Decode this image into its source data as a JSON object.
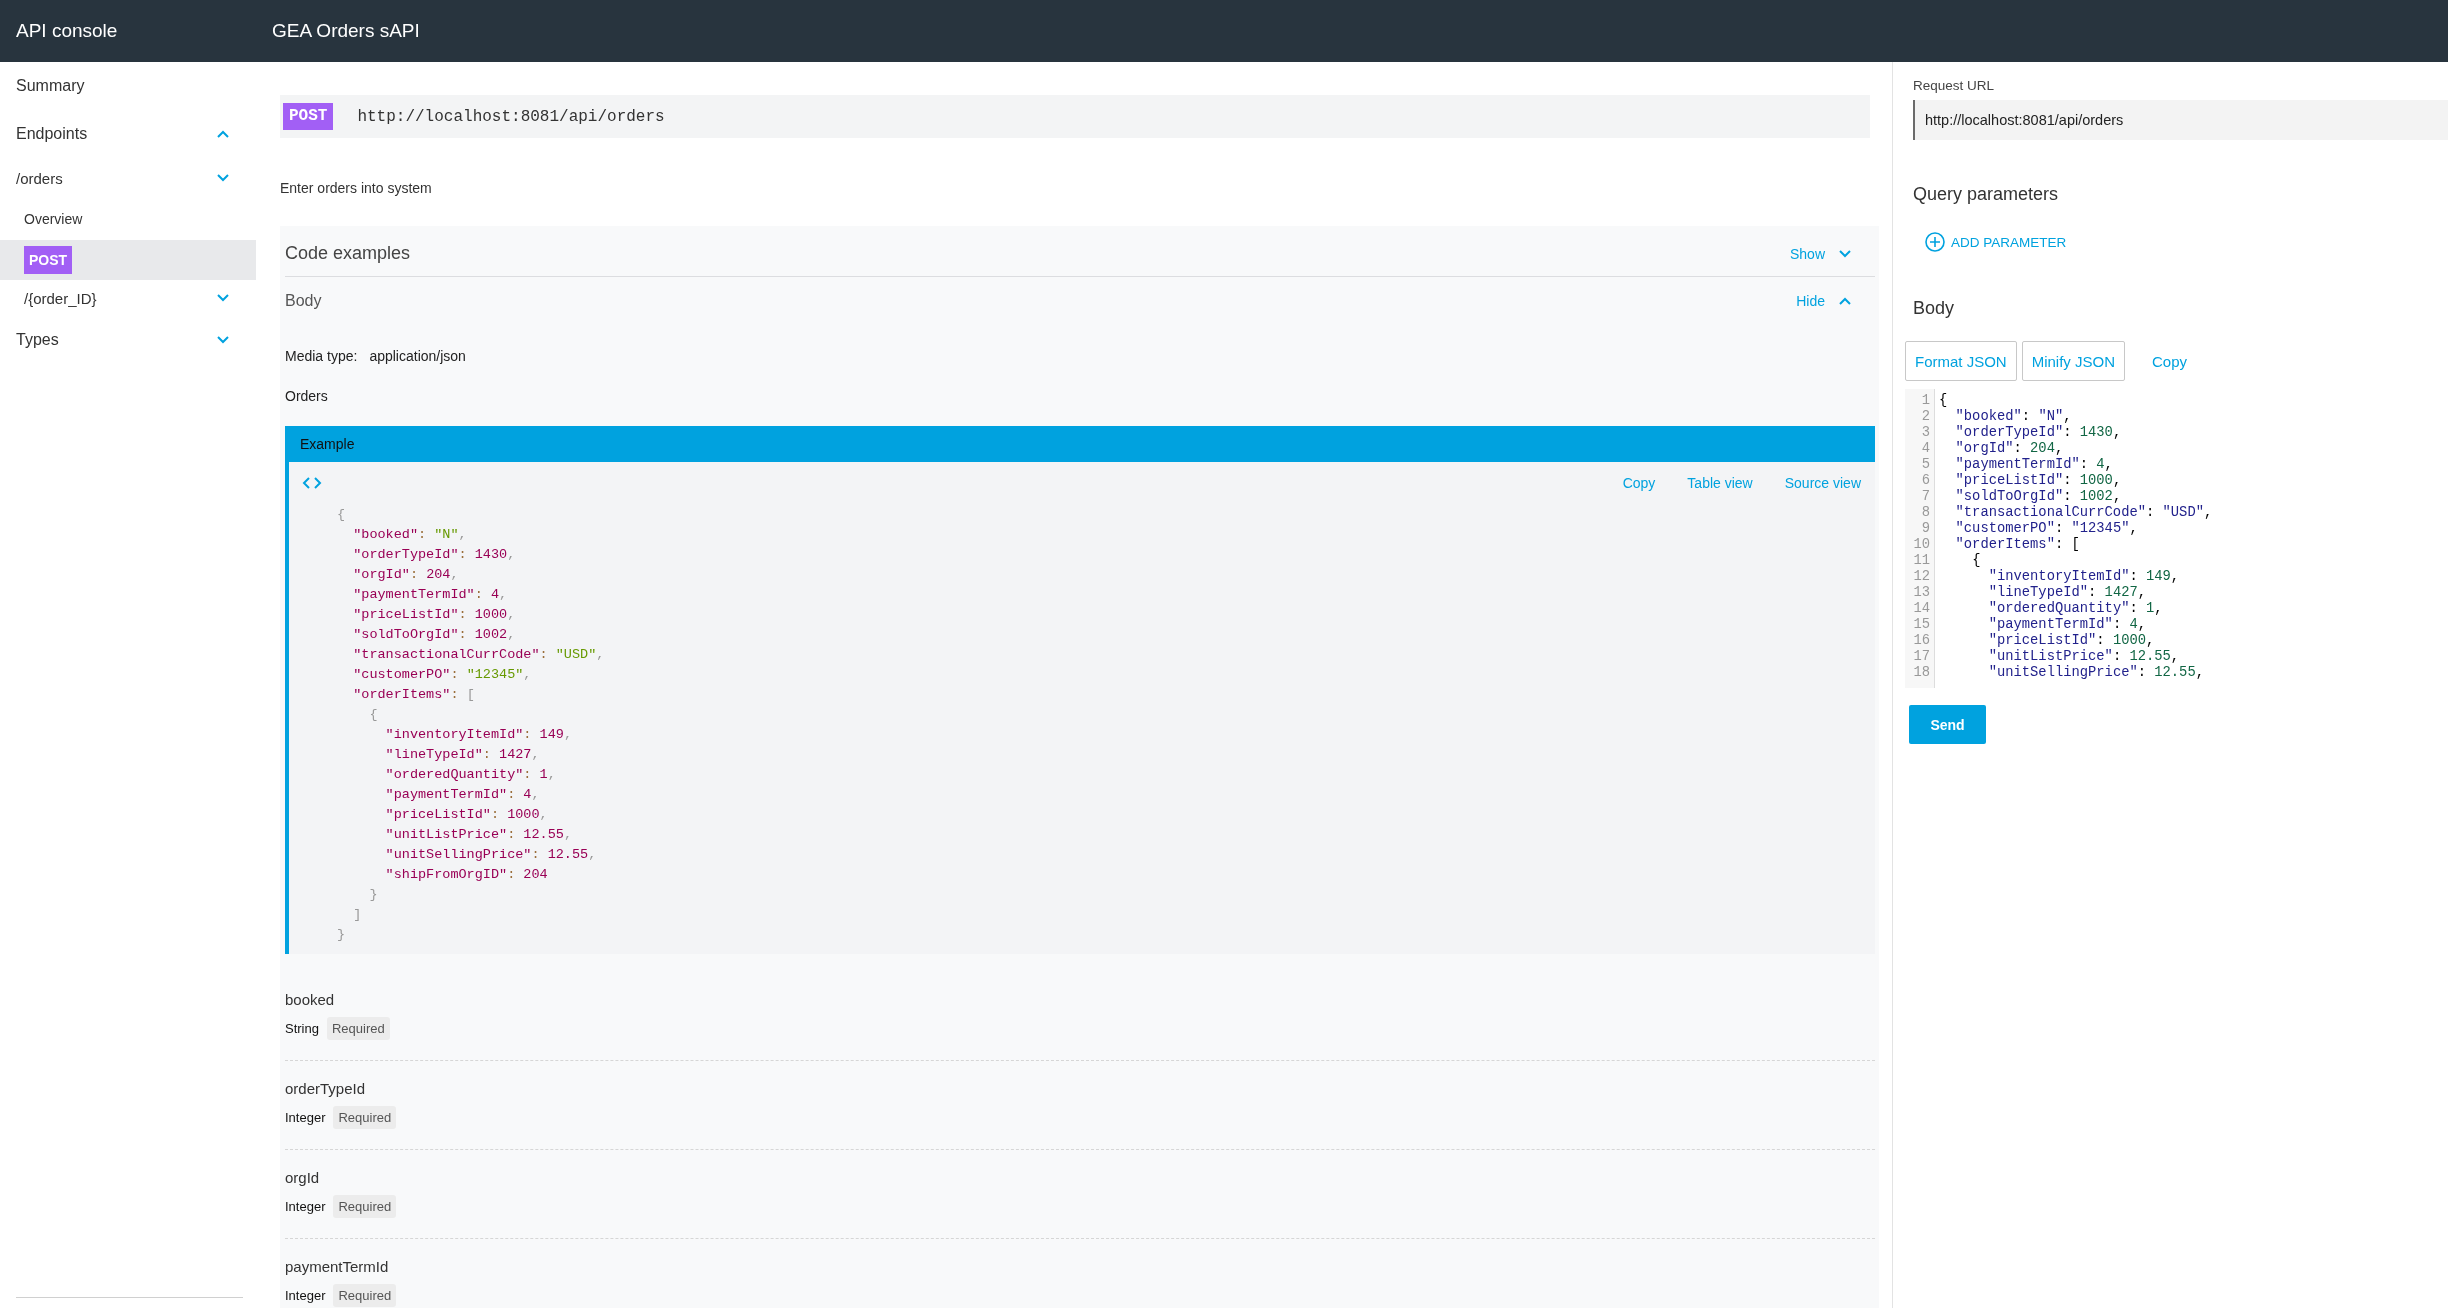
{
  "header": {
    "app_title": "API console",
    "api_title": "GEA Orders sAPI"
  },
  "sidebar": {
    "items": [
      {
        "kind": "heading",
        "label": "Summary",
        "selected": false
      },
      {
        "kind": "heading",
        "label": "Endpoints",
        "selected": false,
        "expanded": true,
        "children": [
          {
            "kind": "group",
            "label": "/orders",
            "selected": false,
            "expanded": false,
            "children": [
              {
                "kind": "page",
                "label": "Overview",
                "selected": false
              },
              {
                "kind": "method",
                "label": "POST",
                "selected": true
              },
              {
                "kind": "group",
                "label": "/{order_ID}",
                "selected": false,
                "expanded": false
              }
            ]
          }
        ]
      },
      {
        "kind": "heading",
        "label": "Types",
        "selected": false,
        "expanded": false
      }
    ]
  },
  "endpoint": {
    "method": "POST",
    "url": "http://localhost:8081/api/orders",
    "description": "Enter orders into system"
  },
  "docs": {
    "code_examples": {
      "title": "Code examples",
      "toggle": "Show",
      "expanded": false
    },
    "body": {
      "title": "Body",
      "toggle": "Hide",
      "expanded": true
    },
    "media_type_label": "Media type:",
    "media_type": "application/json",
    "schema": "Orders",
    "example": {
      "title": "Example",
      "actions": [
        "Copy",
        "Table view",
        "Source view"
      ],
      "lines": [
        "{",
        "  \"booked\": \"N\",",
        "  \"orderTypeId\": 1430,",
        "  \"orgId\": 204,",
        "  \"paymentTermId\": 4,",
        "  \"priceListId\": 1000,",
        "  \"soldToOrgId\": 1002,",
        "  \"transactionalCurrCode\": \"USD\",",
        "  \"customerPO\": \"12345\",",
        "  \"orderItems\": [",
        "    {",
        "      \"inventoryItemId\": 149,",
        "      \"lineTypeId\": 1427,",
        "      \"orderedQuantity\": 1,",
        "      \"paymentTermId\": 4,",
        "      \"priceListId\": 1000,",
        "      \"unitListPrice\": 12.55,",
        "      \"unitSellingPrice\": 12.55,",
        "      \"shipFromOrgID\": 204",
        "    }",
        "  ]",
        "}"
      ]
    },
    "properties": [
      {
        "name": "booked",
        "type": "String",
        "flag": "Required"
      },
      {
        "name": "orderTypeId",
        "type": "Integer",
        "flag": "Required"
      },
      {
        "name": "orgId",
        "type": "Integer",
        "flag": "Required"
      },
      {
        "name": "paymentTermId",
        "type": "Integer",
        "flag": "Required"
      }
    ]
  },
  "console": {
    "url_label": "Request URL",
    "url": "http://localhost:8081/api/orders",
    "query_title": "Query parameters",
    "add_parameter": "ADD PARAMETER",
    "body_title": "Body",
    "tools": [
      {
        "kind": "outlined",
        "label": "Format JSON"
      },
      {
        "kind": "outlined",
        "label": "Minify JSON"
      },
      {
        "kind": "link",
        "label": "Copy"
      }
    ],
    "lines": [
      {
        "number": "1",
        "text": "{"
      },
      {
        "number": "2",
        "text": "  \"booked\": \"N\","
      },
      {
        "number": "3",
        "text": "  \"orderTypeId\": 1430,"
      },
      {
        "number": "4",
        "text": "  \"orgId\": 204,"
      },
      {
        "number": "5",
        "text": "  \"paymentTermId\": 4,"
      },
      {
        "number": "6",
        "text": "  \"priceListId\": 1000,"
      },
      {
        "number": "7",
        "text": "  \"soldToOrgId\": 1002,"
      },
      {
        "number": "8",
        "text": "  \"transactionalCurrCode\": \"USD\","
      },
      {
        "number": "9",
        "text": "  \"customerPO\": \"12345\","
      },
      {
        "number": "10",
        "text": "  \"orderItems\": ["
      },
      {
        "number": "11",
        "text": "    {"
      },
      {
        "number": "12",
        "text": "      \"inventoryItemId\": 149,"
      },
      {
        "number": "13",
        "text": "      \"lineTypeId\": 1427,"
      },
      {
        "number": "14",
        "text": "      \"orderedQuantity\": 1,"
      },
      {
        "number": "15",
        "text": "      \"paymentTermId\": 4,"
      },
      {
        "number": "16",
        "text": "      \"priceListId\": 1000,"
      },
      {
        "number": "17",
        "text": "      \"unitListPrice\": 12.55,"
      },
      {
        "number": "18",
        "text": "      \"unitSellingPrice\": 12.55,"
      }
    ],
    "send": "Send"
  }
}
